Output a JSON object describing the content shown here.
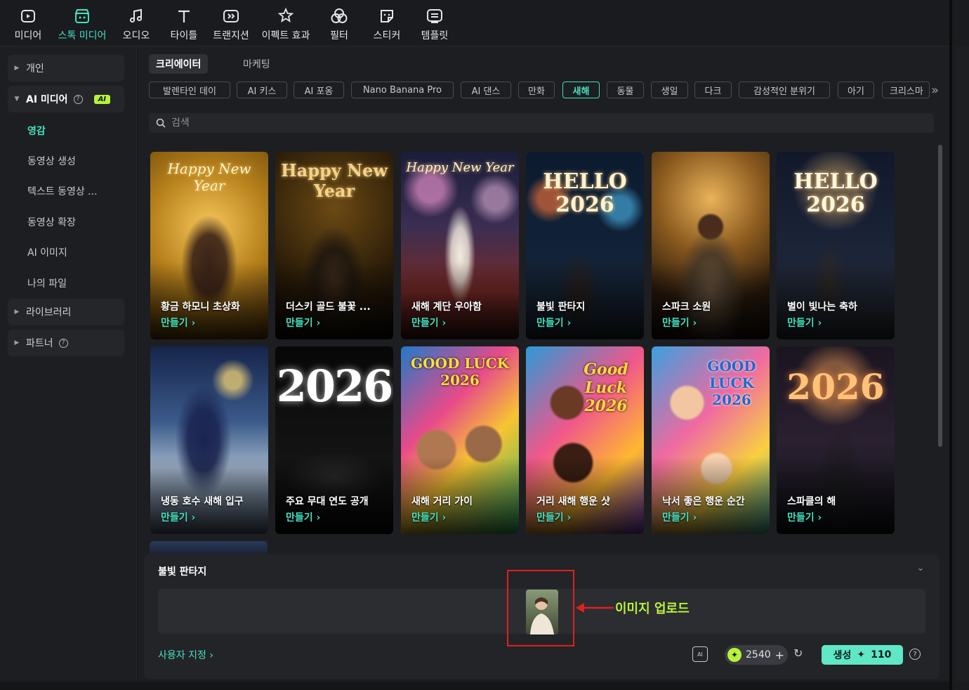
{
  "toolbar": {
    "items": [
      {
        "label": "미디어",
        "icon": "media-icon",
        "active": false
      },
      {
        "label": "스톡 미디어",
        "icon": "stock-media-icon",
        "active": true
      },
      {
        "label": "오디오",
        "icon": "music-note-icon",
        "active": false
      },
      {
        "label": "타이틀",
        "icon": "text-t-icon",
        "active": false
      },
      {
        "label": "트랜지션",
        "icon": "transition-icon",
        "active": false
      },
      {
        "label": "이펙트 효과",
        "icon": "effect-star-icon",
        "active": false
      },
      {
        "label": "필터",
        "icon": "filter-icon",
        "active": false
      },
      {
        "label": "스티커",
        "icon": "sticker-icon",
        "active": false
      },
      {
        "label": "템플릿",
        "icon": "template-icon",
        "active": false
      }
    ]
  },
  "sidebar": {
    "groups": [
      {
        "label": "개인"
      },
      {
        "label": "AI 미디어",
        "badge": "AI"
      },
      {
        "label": "라이브러리"
      },
      {
        "label": "파트너"
      }
    ],
    "items": [
      {
        "label": "영감",
        "active": true
      },
      {
        "label": "동영상 생성"
      },
      {
        "label": "텍스트 동영상 ..."
      },
      {
        "label": "동영상 확장"
      },
      {
        "label": "AI 이미지"
      },
      {
        "label": "나의 파일"
      }
    ]
  },
  "tabs": [
    {
      "label": "크리에이터",
      "active": true
    },
    {
      "label": "마케팅",
      "active": false
    }
  ],
  "chips": [
    {
      "label": "발렌타인 데이"
    },
    {
      "label": "AI 키스"
    },
    {
      "label": "AI 포옹"
    },
    {
      "label": "Nano Banana Pro"
    },
    {
      "label": "AI 댄스"
    },
    {
      "label": "만화"
    },
    {
      "label": "새해",
      "active": true
    },
    {
      "label": "동물"
    },
    {
      "label": "생일"
    },
    {
      "label": "다크"
    },
    {
      "label": "감성적인 분위기"
    },
    {
      "label": "아기"
    },
    {
      "label": "크리스마"
    }
  ],
  "search": {
    "placeholder": "검색"
  },
  "cards": [
    {
      "title": "황금 하모니 초상화",
      "cta": "만들기",
      "headline": "Happy New Year"
    },
    {
      "title": "더스키 골드 불꽃 ...",
      "cta": "만들기",
      "headline": "Happy New Year"
    },
    {
      "title": "새해 계단 우아함",
      "cta": "만들기",
      "headline": "Happy New Year"
    },
    {
      "title": "불빛 판타지",
      "cta": "만들기",
      "headline": "HELLO 2026"
    },
    {
      "title": "스파크 소원",
      "cta": "만들기",
      "headline": ""
    },
    {
      "title": "별이 빛나는 축하",
      "cta": "만들기",
      "headline": "HELLO 2026"
    },
    {
      "title": "냉동 호수 새해 입구",
      "cta": "만들기",
      "headline": ""
    },
    {
      "title": "주요 무대 연도 공개",
      "cta": "만들기",
      "headline": "2026"
    },
    {
      "title": "새해 거리 가이",
      "cta": "만들기",
      "headline": "GOOD LUCK 2026"
    },
    {
      "title": "거리 새해 행운 샷",
      "cta": "만들기",
      "headline": "Good Luck 2026"
    },
    {
      "title": "낙서 좋은 행운 순간",
      "cta": "만들기",
      "headline": "GOOD LUCK 2026"
    },
    {
      "title": "스파클의 해",
      "cta": "만들기",
      "headline": "2026"
    }
  ],
  "bottom_panel": {
    "title": "불빛 판타지",
    "custom_link": "사용자 지정",
    "credits": "2540",
    "generate_label": "생성",
    "generate_cost": "110",
    "annotation": "이미지 업로드"
  }
}
